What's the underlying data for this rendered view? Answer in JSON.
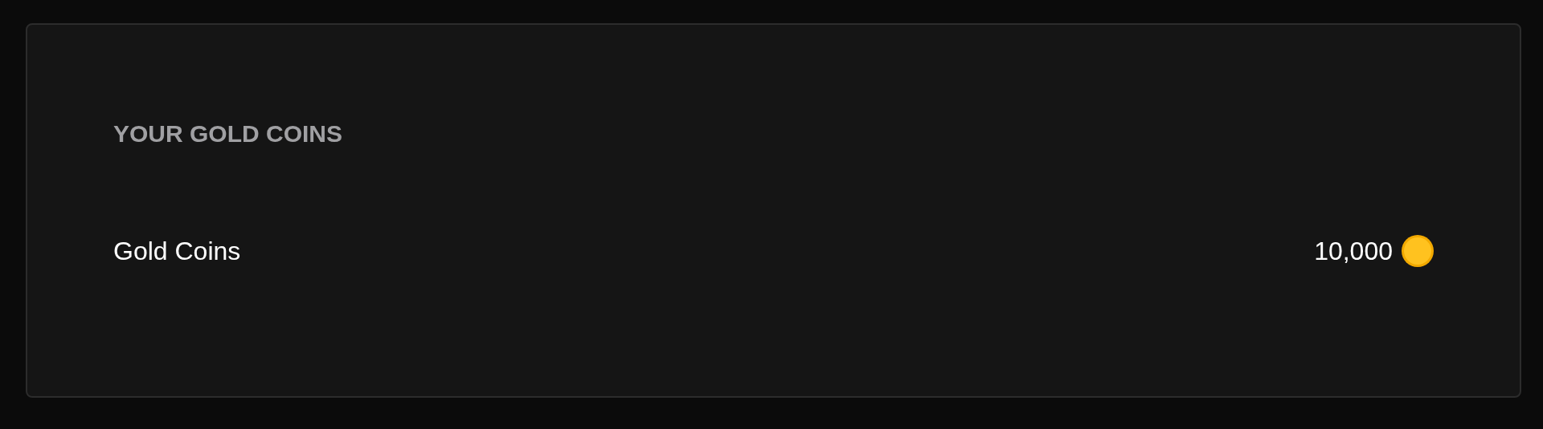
{
  "section": {
    "heading": "YOUR GOLD COINS",
    "rows": [
      {
        "label": "Gold Coins",
        "value": "10,000"
      }
    ]
  }
}
